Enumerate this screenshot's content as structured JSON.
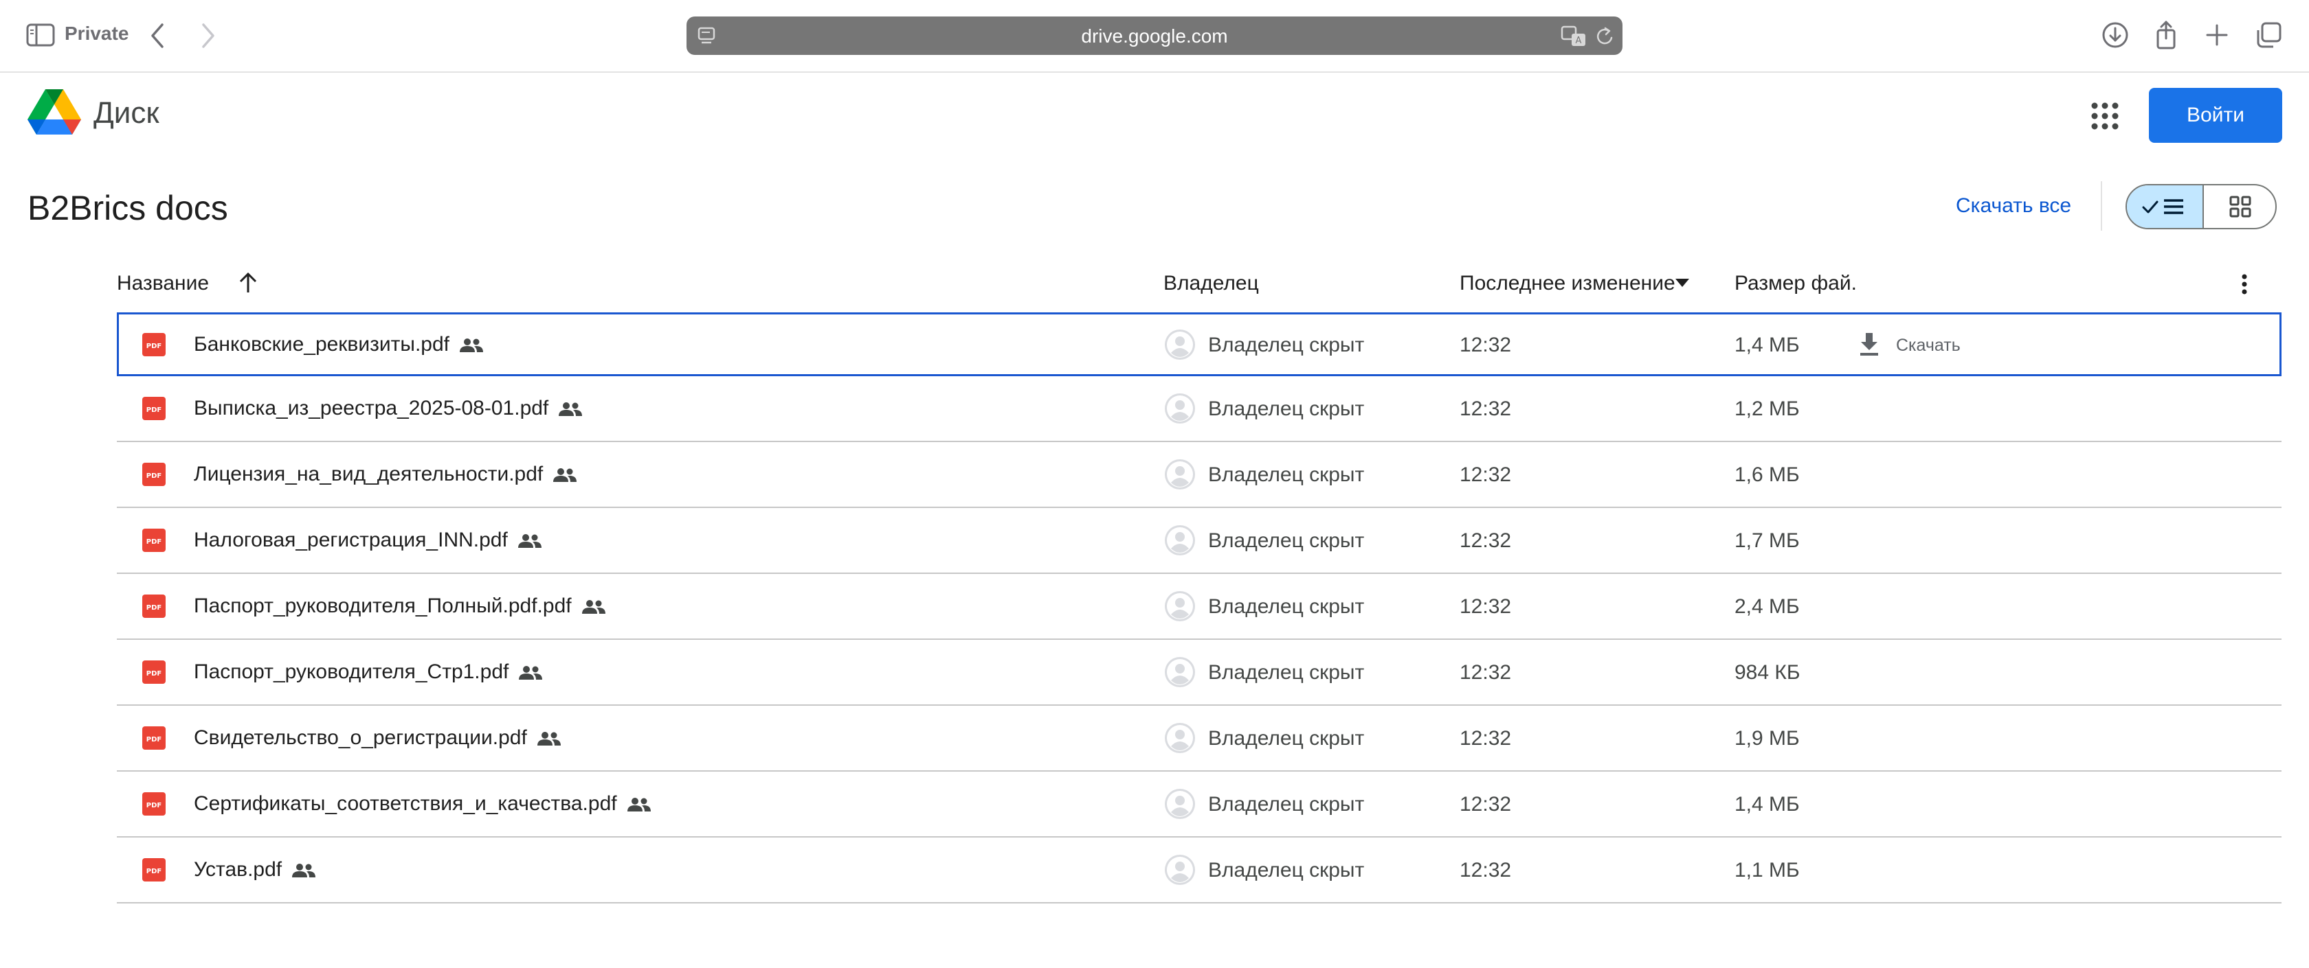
{
  "browser": {
    "private_label": "Private",
    "url": "drive.google.com"
  },
  "header": {
    "app_name": "Диск",
    "signin_label": "Войти"
  },
  "folder": {
    "title": "B2Brics docs",
    "download_all_label": "Скачать все"
  },
  "table": {
    "columns": {
      "name": "Название",
      "owner": "Владелец",
      "modified": "Последнее изменение",
      "size": "Размер фай."
    },
    "download_label": "Скачать",
    "rows": [
      {
        "name": "Банковские_реквизиты.pdf",
        "owner": "Владелец скрыт",
        "modified": "12:32",
        "size": "1,4 МБ"
      },
      {
        "name": "Выписка_из_реестра_2025-08-01.pdf",
        "owner": "Владелец скрыт",
        "modified": "12:32",
        "size": "1,2 МБ"
      },
      {
        "name": "Лицензия_на_вид_деятельности.pdf",
        "owner": "Владелец скрыт",
        "modified": "12:32",
        "size": "1,6 МБ"
      },
      {
        "name": "Налоговая_регистрация_INN.pdf",
        "owner": "Владелец скрыт",
        "modified": "12:32",
        "size": "1,7 МБ"
      },
      {
        "name": "Паспорт_руководителя_Полный.pdf.pdf",
        "owner": "Владелец скрыт",
        "modified": "12:32",
        "size": "2,4 МБ"
      },
      {
        "name": "Паспорт_руководителя_Стр1.pdf",
        "owner": "Владелец скрыт",
        "modified": "12:32",
        "size": "984 КБ"
      },
      {
        "name": "Свидетельство_о_регистрации.pdf",
        "owner": "Владелец скрыт",
        "modified": "12:32",
        "size": "1,9 МБ"
      },
      {
        "name": "Сертификаты_соответствия_и_качества.pdf",
        "owner": "Владелец скрыт",
        "modified": "12:32",
        "size": "1,4 МБ"
      },
      {
        "name": "Устав.pdf",
        "owner": "Владелец скрыт",
        "modified": "12:32",
        "size": "1,1 МБ"
      }
    ]
  },
  "icons": {
    "sidebar": "sidebar-icon",
    "back": "chevron-left-icon",
    "forward": "chevron-right-icon",
    "page": "page-icon",
    "translate": "translate-icon",
    "reload": "reload-icon",
    "downloads": "download-circle-icon",
    "share": "share-icon",
    "new_tab": "plus-icon",
    "tabs": "tabs-icon",
    "drive_logo": "google-drive-logo",
    "apps": "apps-grid-icon",
    "list_view": "list-view-icon",
    "grid_view": "grid-view-icon",
    "sort": "arrow-up-icon",
    "sort_caret": "caret-down-icon",
    "more": "more-vert-icon",
    "file": "pdf-icon",
    "shared": "people-icon",
    "owner": "avatar-icon",
    "download": "download-icon"
  },
  "colors": {
    "accent": "#1a73e8",
    "link": "#0b57d0",
    "pdf": "#ea4335",
    "toggle_active": "#c2e7ff",
    "selection_border": "#1a57d0"
  }
}
